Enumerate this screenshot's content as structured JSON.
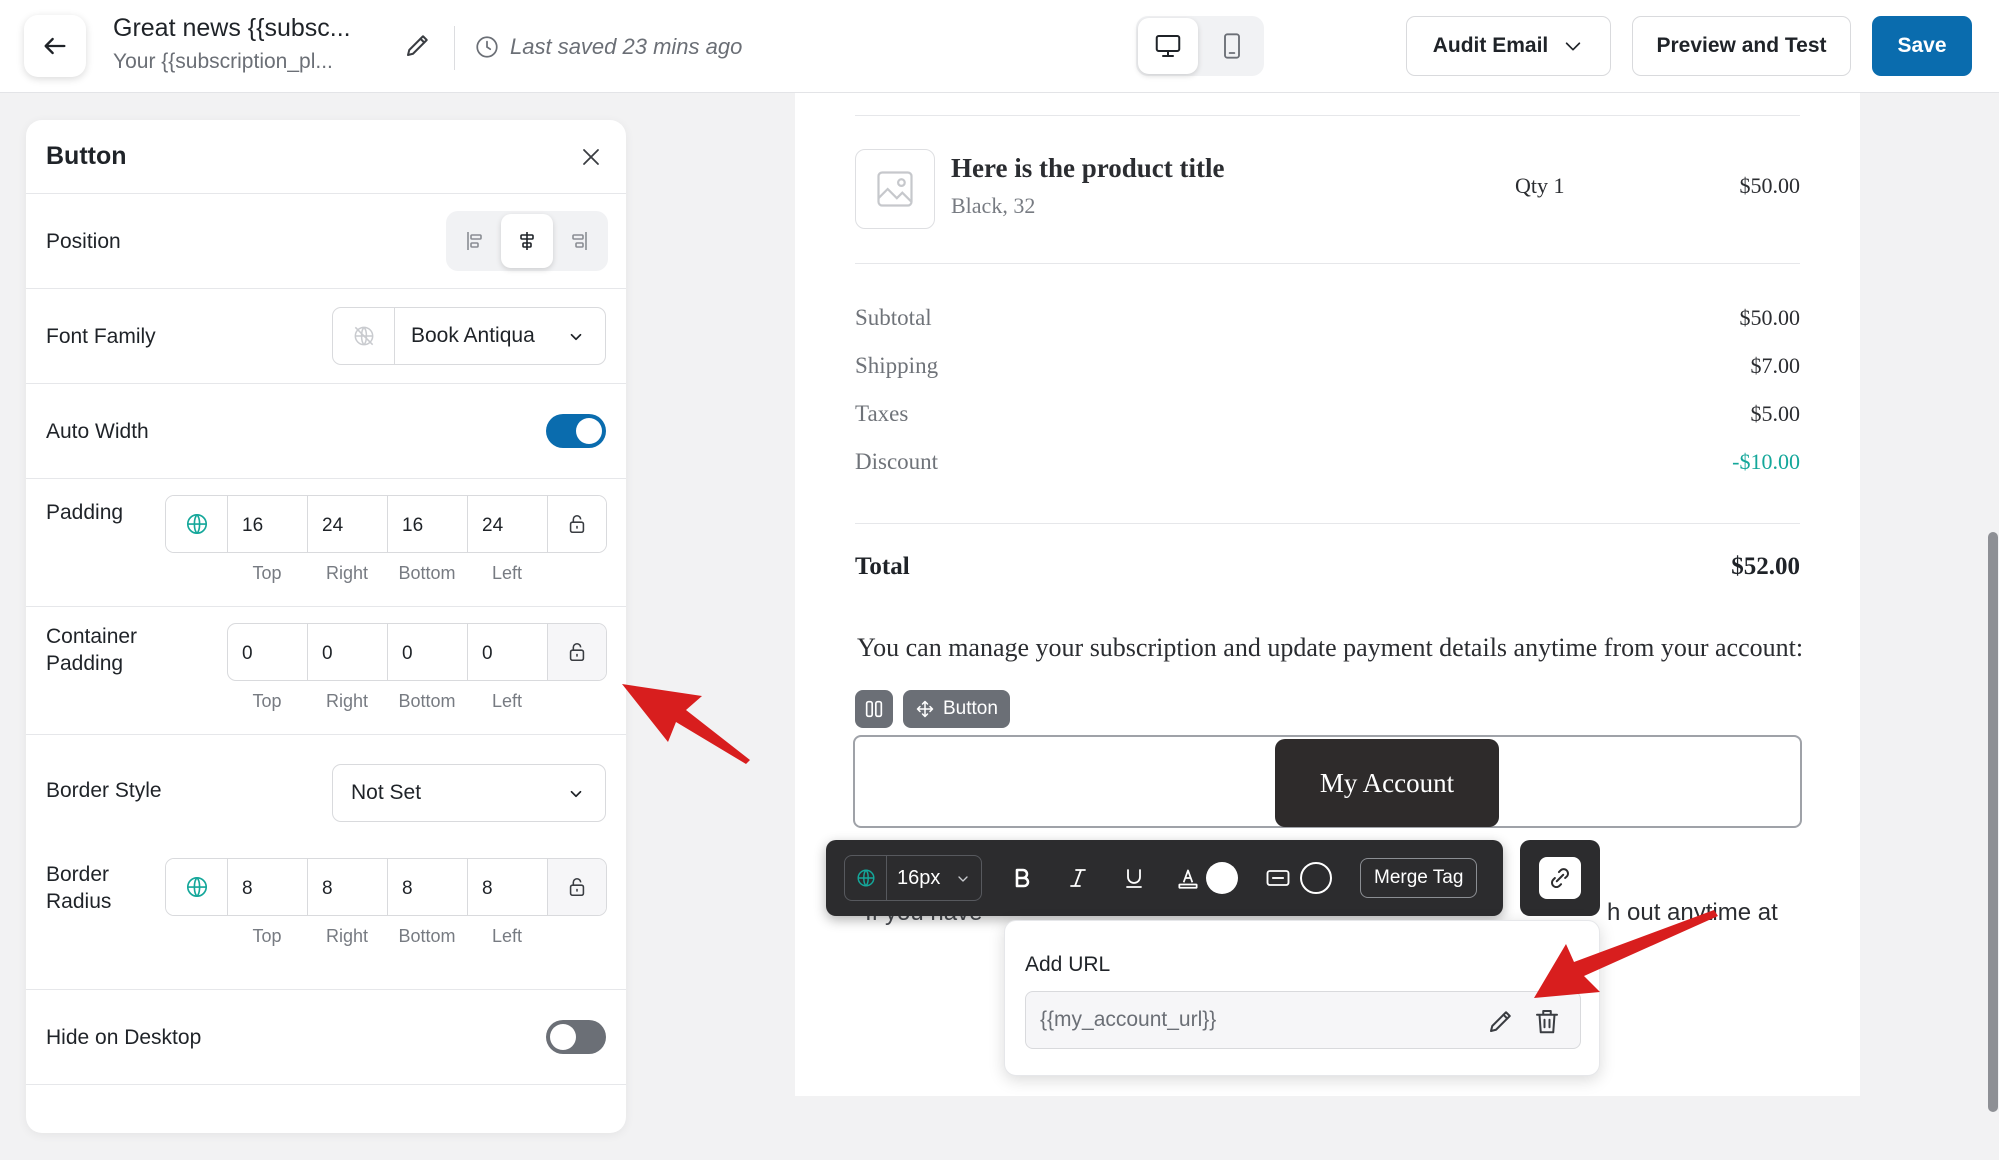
{
  "header": {
    "title": "Great news {{subsc...",
    "subtitle": "Your {{subscription_pl...",
    "last_saved": "Last saved 23 mins ago",
    "audit_label": "Audit Email",
    "preview_label": "Preview and Test",
    "save_label": "Save"
  },
  "panel": {
    "title": "Button",
    "position_label": "Position",
    "font_family_label": "Font Family",
    "font_family_value": "Book Antiqua",
    "auto_width_label": "Auto Width",
    "auto_width_on": true,
    "padding_label": "Padding",
    "padding": {
      "top": "16",
      "right": "24",
      "bottom": "16",
      "left": "24"
    },
    "container_padding_label": "Container Padding",
    "container_padding": {
      "top": "0",
      "right": "0",
      "bottom": "0",
      "left": "0"
    },
    "border_style_label": "Border Style",
    "border_style_value": "Not Set",
    "border_radius_label": "Border Radius",
    "border_radius": {
      "top": "8",
      "right": "8",
      "bottom": "8",
      "left": "8"
    },
    "side_labels": {
      "top": "Top",
      "right": "Right",
      "bottom": "Bottom",
      "left": "Left"
    },
    "hide_desktop_label": "Hide on Desktop",
    "hide_desktop_on": false
  },
  "email": {
    "product_title": "Here is the product title",
    "product_variant": "Black, 32",
    "product_qty": "Qty 1",
    "product_price": "$50.00",
    "summary": [
      {
        "label": "Subtotal",
        "value": "$50.00"
      },
      {
        "label": "Shipping",
        "value": "$7.00"
      },
      {
        "label": "Taxes",
        "value": "$5.00"
      },
      {
        "label": "Discount",
        "value": "-$10.00"
      }
    ],
    "total_label": "Total",
    "total_value": "$52.00",
    "manage_text": "You can manage your subscription and update payment details anytime from your account:",
    "block_tag": "Button",
    "button_text": "My Account",
    "help_text_left": "If you have",
    "help_text_right": "h out anytime at"
  },
  "toolbar": {
    "font_size": "16px",
    "merge_tag_label": "Merge Tag"
  },
  "url_popover": {
    "title": "Add URL",
    "value": "{{my_account_url}}"
  },
  "colors": {
    "accent": "#0a6cae",
    "discount": "#14a79a",
    "annotation_arrow": "#d81e1e"
  }
}
